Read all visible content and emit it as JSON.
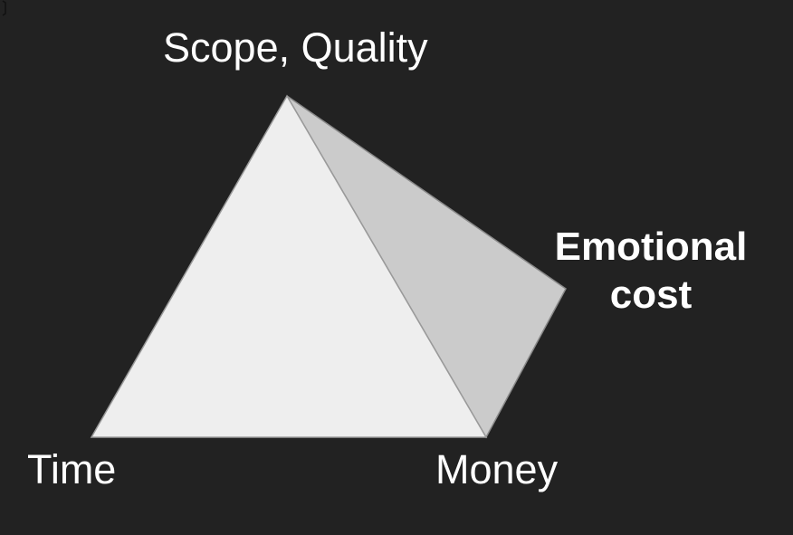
{
  "diagram": {
    "vertex_top_label": "Scope, Quality",
    "vertex_left_label": "Time",
    "vertex_bottom_right_label": "Money",
    "vertex_right_label_line1": "Emotional",
    "vertex_right_label_line2": "cost"
  },
  "colors": {
    "background": "#222222",
    "front_face": "#eeeeee",
    "side_face": "#cbcbcb",
    "edge": "#8a8a8a",
    "text": "#ffffff"
  }
}
